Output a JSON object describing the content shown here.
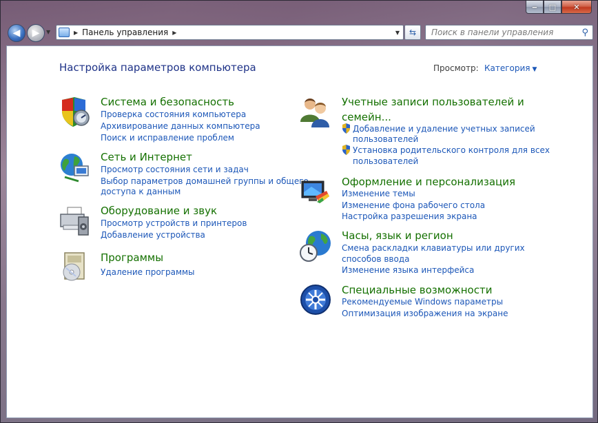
{
  "window": {
    "caption": {
      "minimize": "‒",
      "maximize": "□",
      "close": "✕"
    }
  },
  "nav": {
    "back_glyph": "◀",
    "forward_glyph": "▶",
    "address": {
      "icon": "control-panel-icon",
      "path": "Панель управления",
      "separator": "▶"
    },
    "search_placeholder": "Поиск в панели управления"
  },
  "content": {
    "title": "Настройка параметров компьютера",
    "view": {
      "label": "Просмотр:",
      "value": "Категория"
    },
    "left": [
      {
        "title": "Система и безопасность",
        "icon": "shield-system-icon",
        "links": [
          "Проверка состояния компьютера",
          "Архивирование данных компьютера",
          "Поиск и исправление проблем"
        ]
      },
      {
        "title": "Сеть и Интернет",
        "icon": "network-globe-icon",
        "links": [
          "Просмотр состояния сети и задач",
          "Выбор параметров домашней группы и общего",
          "доступа к данным"
        ]
      },
      {
        "title": "Оборудование и звук",
        "icon": "printer-hardware-icon",
        "links": [
          "Просмотр устройств и принтеров",
          "Добавление устройства"
        ]
      },
      {
        "title": "Программы",
        "icon": "programs-disc-icon",
        "links": [
          "Удаление программы"
        ]
      }
    ],
    "right": [
      {
        "title_line1": "Учетные записи пользователей и",
        "title_line2": "семейн...",
        "icon": "users-icon",
        "links": [
          "Добавление и удаление учетных записей",
          "пользователей",
          "Установка родительского контроля для всех",
          "пользователей"
        ]
      },
      {
        "title": "Оформление и персонализация",
        "icon": "monitor-paint-icon",
        "links": [
          "Изменение темы",
          "Изменение фона рабочего стола",
          "Настройка разрешения экрана"
        ]
      },
      {
        "title": "Часы, язык и регион",
        "icon": "globe-clock-icon",
        "links": [
          "Смена раскладки клавиатуры или других",
          "способов ввода",
          "Изменение языка интерфейса"
        ]
      },
      {
        "title": "Специальные возможности",
        "icon": "ease-of-access-icon",
        "links": [
          "Рекомендуемые Windows параметры",
          "Оптимизация изображения на экране"
        ]
      }
    ]
  },
  "colors": {
    "title_blue": "#1e3287",
    "category_green": "#147000",
    "link_blue": "#1c57b8"
  }
}
